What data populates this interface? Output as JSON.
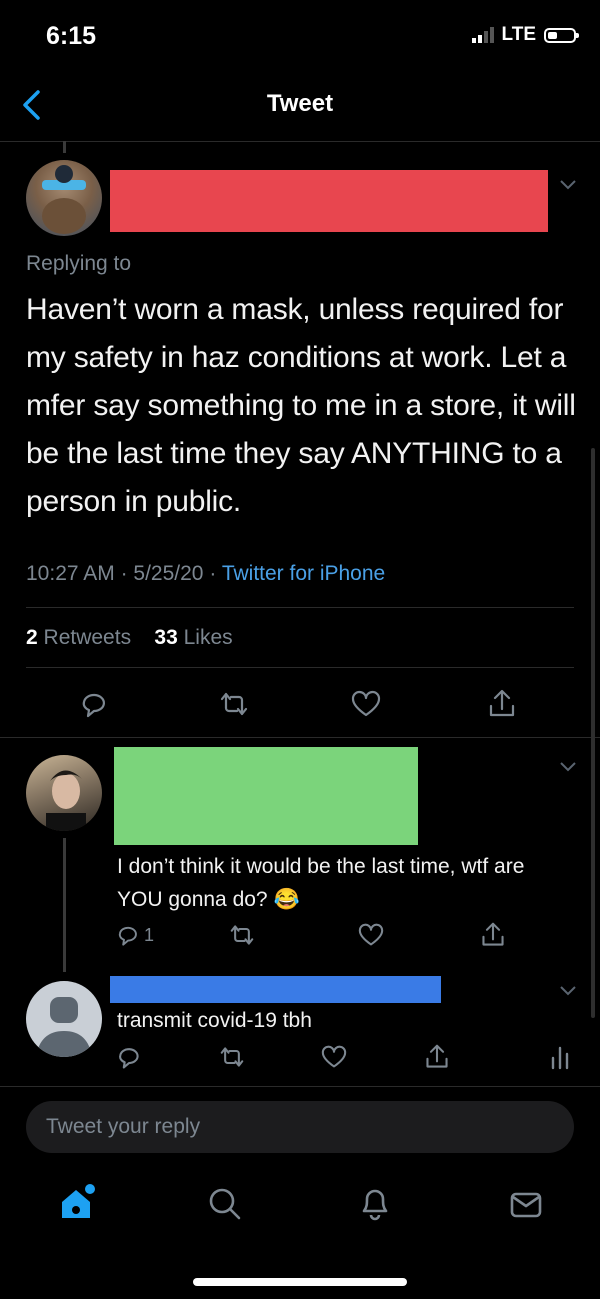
{
  "status_bar": {
    "time": "6:15",
    "network": "LTE"
  },
  "header": {
    "title": "Tweet"
  },
  "main_tweet": {
    "replying_to": "Replying to",
    "text": "Haven’t worn a mask, unless required for my safety in haz conditions at work. Let a mfer say something to me in a store, it will be the last time they say ANYTHING to a person in public.",
    "time": "10:27 AM",
    "sep1": "·",
    "date": "5/25/20",
    "sep2": "·",
    "source": "Twitter for iPhone",
    "retweets_count": "2",
    "retweets_label": "Retweets",
    "likes_count": "33",
    "likes_label": "Likes",
    "redaction_color": "#e8464f"
  },
  "replies": [
    {
      "text": "I don’t think it would be the last time, wtf are YOU gonna do?",
      "emoji": "😂",
      "reply_count": "1",
      "redaction_color": "#7bd47b"
    },
    {
      "text": "transmit covid-19 tbh",
      "redaction_color": "#3a7be6"
    }
  ],
  "composer": {
    "placeholder": "Tweet your reply"
  },
  "tab_bar": {
    "items": [
      "home-icon",
      "search-icon",
      "notifications-icon",
      "messages-icon"
    ]
  },
  "colors": {
    "accent": "#1da1f2",
    "muted": "#7d8791"
  }
}
